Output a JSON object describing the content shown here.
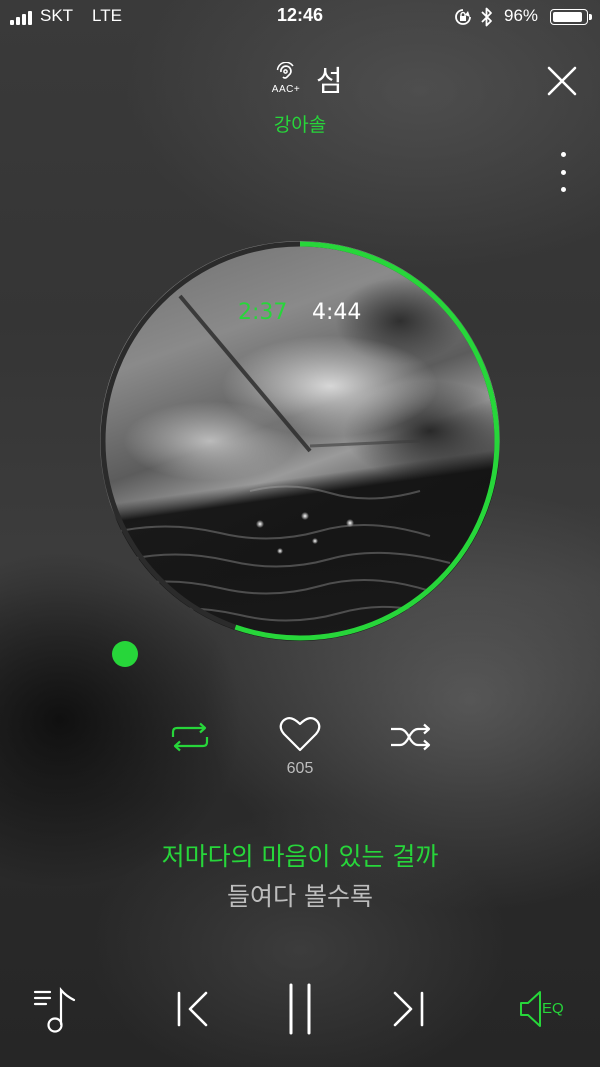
{
  "status_bar": {
    "carrier": "SKT",
    "network": "LTE",
    "time": "12:46",
    "battery_percent_label": "96%",
    "battery_level": 0.96
  },
  "header": {
    "quality_label": "AAC+",
    "title": "섬",
    "artist": "강아솔"
  },
  "player": {
    "elapsed": "2:37",
    "total": "4:44",
    "progress_fraction": 0.553
  },
  "actions": {
    "like_count": "605"
  },
  "lyrics": {
    "current_line": "저마다의 마음이 있는 걸까",
    "next_line": "들여다 볼수록"
  },
  "controls": {
    "eq_label": "EQ"
  },
  "colors": {
    "accent": "#27d63a",
    "secondary_text": "#bdbdbd",
    "ring_track": "#2b2b2b"
  },
  "icons": {
    "close": "close-icon",
    "more": "more-vertical-icon",
    "repeat": "repeat-icon",
    "like": "heart-icon",
    "shuffle": "shuffle-icon",
    "playlist": "playlist-icon",
    "previous": "previous-icon",
    "pause": "pause-icon",
    "next": "next-icon",
    "eq": "eq-speaker-icon"
  }
}
